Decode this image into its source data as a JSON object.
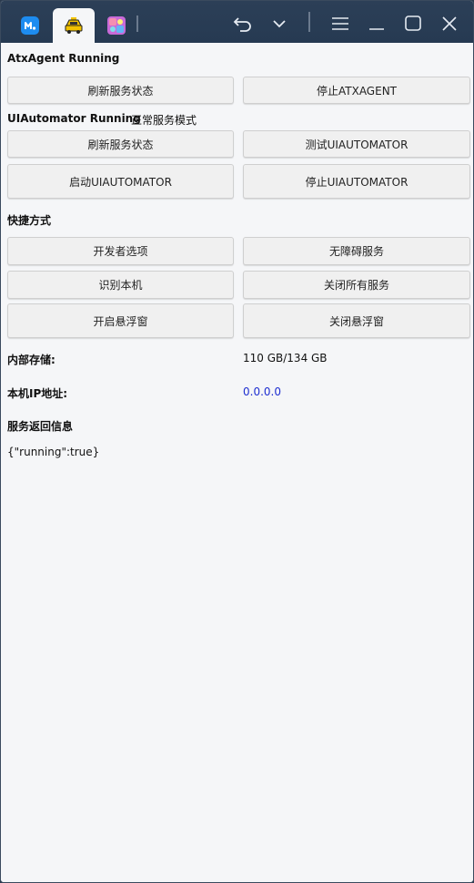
{
  "titlebar": {
    "tabs": [
      {
        "name": "meituan-app-tab",
        "icon": "m-logo-icon"
      },
      {
        "name": "taxi-app-tab",
        "icon": "taxi-icon"
      },
      {
        "name": "game-app-tab",
        "icon": "colorful-game-icon"
      }
    ],
    "controls": [
      "undo-icon",
      "chevron-down-icon",
      "menu-icon",
      "minimize-icon",
      "maximize-icon",
      "close-icon"
    ]
  },
  "atx": {
    "status": "AtxAgent Running",
    "refresh_label": "刷新服务状态",
    "stop_label": "停止ATXAGENT"
  },
  "uia": {
    "status": "UIAutomator Running",
    "mode": "正常服务模式",
    "refresh_label": "刷新服务状态",
    "test_label": "测试UIAUTOMATOR",
    "start_label": "启动UIAUTOMATOR",
    "stop_label": "停止UIAUTOMATOR"
  },
  "shortcuts": {
    "heading": "快捷方式",
    "developer_options": "开发者选项",
    "accessibility": "无障碍服务",
    "identify_device": "识别本机",
    "close_all_services": "关闭所有服务",
    "open_float": "开启悬浮窗",
    "close_float": "关闭悬浮窗"
  },
  "info": {
    "storage_label": "内部存储:",
    "storage_value": "110 GB/134 GB",
    "ip_label": "本机IP地址:",
    "ip_value": "0.0.0.0",
    "response_heading": "服务返回信息",
    "response_text": "{\"running\":true}"
  },
  "colors": {
    "titlebar": "#263a52",
    "background": "#f5f6f8",
    "ip_value": "#1f2fd0"
  }
}
